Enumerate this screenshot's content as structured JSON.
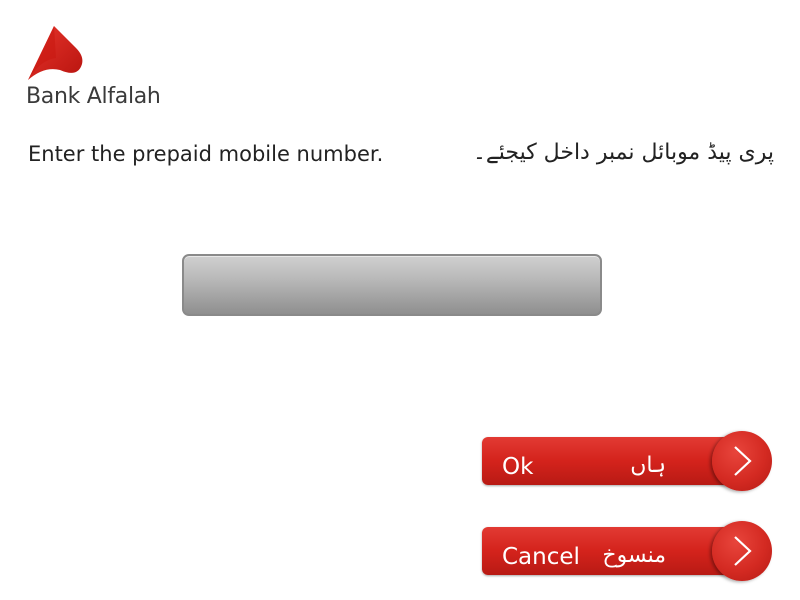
{
  "brand": {
    "name": "Bank Alfalah",
    "logo_color": "#d8231b"
  },
  "prompt": {
    "english": "Enter the prepaid mobile number.",
    "urdu": "پری پیڈ موبائل نمبر داخل کیجئے۔"
  },
  "mobile_input": {
    "value": ""
  },
  "buttons": {
    "ok": {
      "label_en": "Ok",
      "label_ur": "ہاں",
      "icon": "chevron-right-icon"
    },
    "cancel": {
      "label_en": "Cancel",
      "label_ur": "منسوخ",
      "icon": "chevron-right-icon"
    }
  },
  "colors": {
    "button_red": "#d4231c",
    "input_gray": "#b5b5b5",
    "text": "#222222"
  }
}
